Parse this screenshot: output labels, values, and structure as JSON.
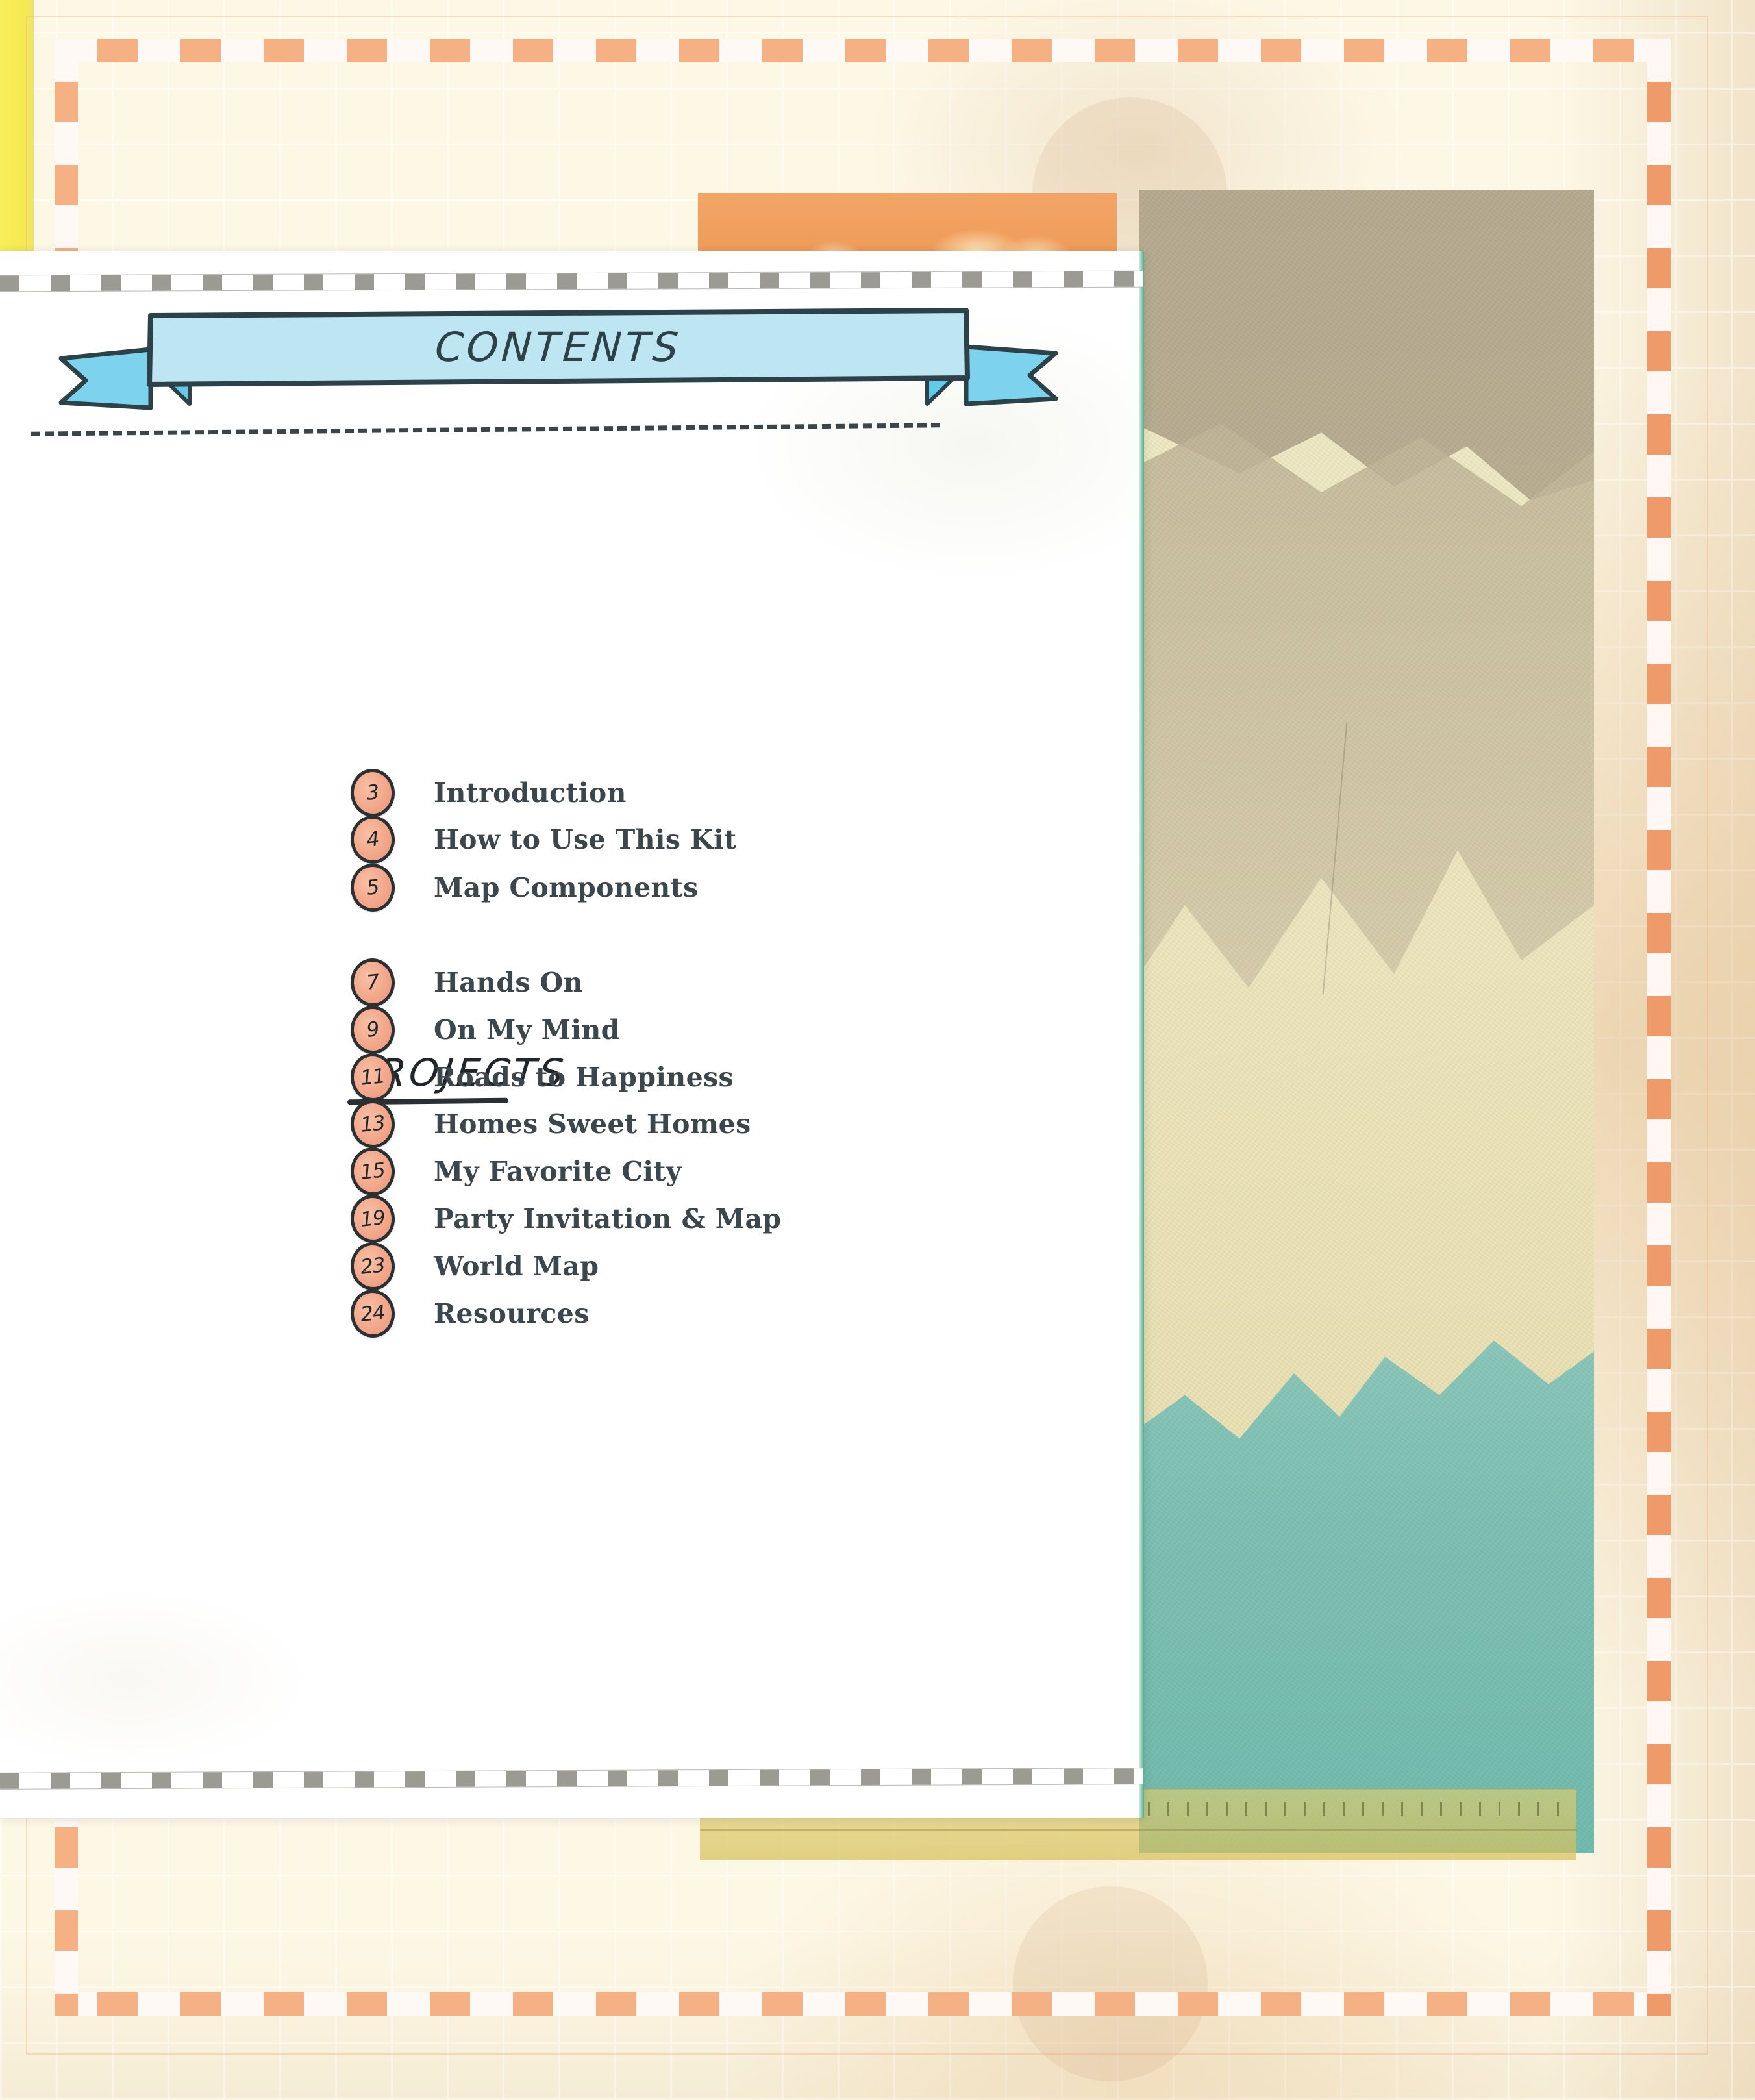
{
  "page": {
    "title": "CONTENTS",
    "section_heading": "PROJECTS"
  },
  "colors": {
    "ribbon_fill": "#b8e3f0",
    "ribbon_tail": "#7dd3ee",
    "ribbon_outline": "#2c4148",
    "badge_fill": "#f0a184",
    "badge_outline": "#2b3033",
    "label_text": "#3b474c",
    "frame_orange": "#f5b183",
    "frame_orange_right": "#f09a6a",
    "yellow_strip": "#f5ea52",
    "photo_teal": "#7fc3b6",
    "photo_tan": "#bbb094",
    "paper_cream": "#fdf8e6",
    "page_edge_green": "#4fae8d",
    "tape_gray": "#9b9b93",
    "ruler_yellow": "#d6c05c"
  },
  "contents": {
    "front_matter": [
      {
        "page": "3",
        "label": "Introduction"
      },
      {
        "page": "4",
        "label": "How to Use This Kit"
      },
      {
        "page": "5",
        "label": "Map Components"
      }
    ],
    "projects": [
      {
        "page": "7",
        "label": "Hands On"
      },
      {
        "page": "9",
        "label": "On My Mind"
      },
      {
        "page": "11",
        "label": "Roads to Happiness"
      },
      {
        "page": "13",
        "label": "Homes Sweet Homes"
      },
      {
        "page": "15",
        "label": "My Favorite City"
      },
      {
        "page": "19",
        "label": "Party Invitation & Map"
      },
      {
        "page": "23",
        "label": "World Map"
      },
      {
        "page": "24",
        "label": "Resources"
      }
    ]
  }
}
